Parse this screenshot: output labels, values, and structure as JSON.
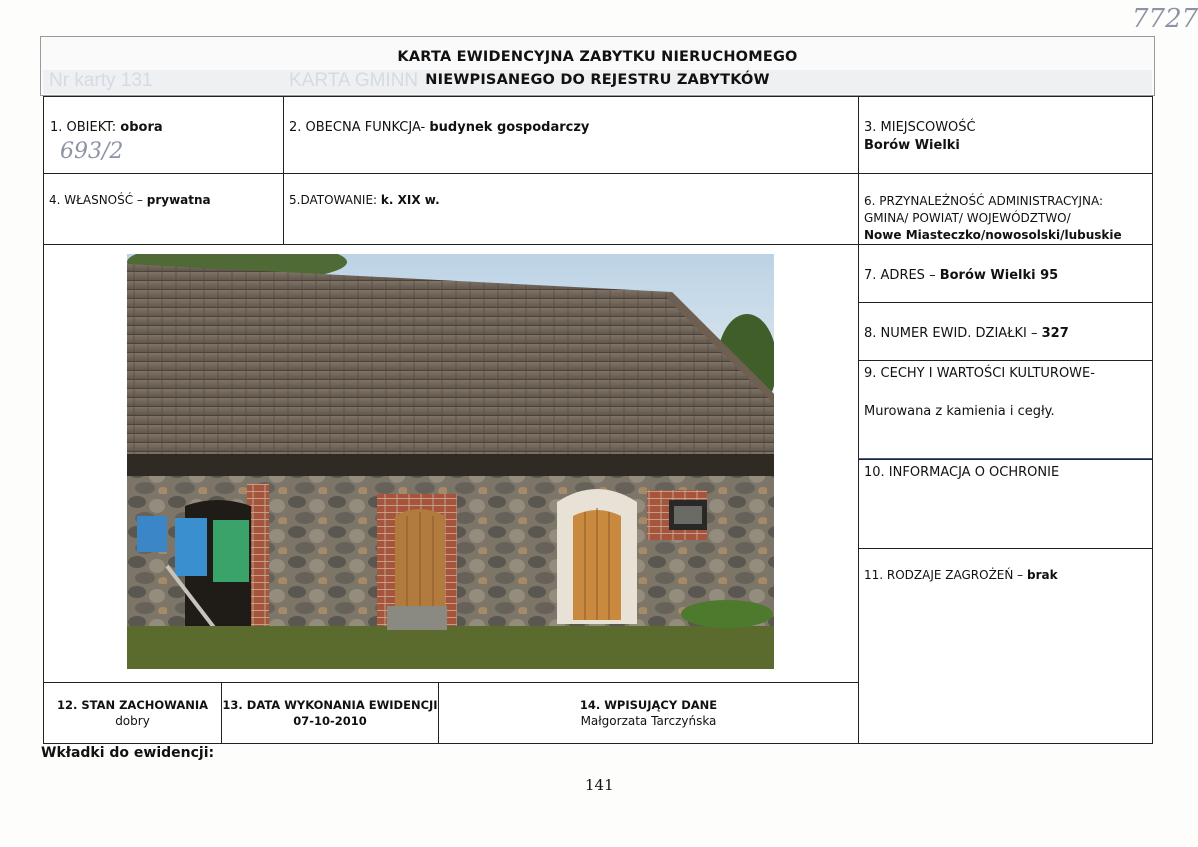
{
  "handwritten_number": "7727",
  "header": {
    "title_line1": "KARTA EWIDENCYJNA ZABYTKU NIERUCHOMEGO",
    "title_line2": "NIEWPISANEGO DO REJESTRU ZABYTKÓW",
    "ghost_left": "Nr karty 131",
    "ghost_right": "KARTA GMINN"
  },
  "field1": {
    "label": "1. OBIEKT: ",
    "value": "obora",
    "handwritten": "693/2"
  },
  "field2": {
    "label": "2. OBECNA FUNKCJA- ",
    "value": "budynek gospodarczy"
  },
  "field3": {
    "label": "3. MIEJSCOWOŚĆ",
    "value": "Borów Wielki"
  },
  "field4": {
    "label": "4. WŁASNOŚĆ – ",
    "value": "prywatna"
  },
  "field5": {
    "label": "5.DATOWANIE: ",
    "value": "k. XIX w."
  },
  "field6": {
    "line1": "6. PRZYNALEŻNOŚĆ ADMINISTRACYJNA:",
    "line2": "GMINA/ POWIAT/ WOJEWÓDZTWO/",
    "value": "Nowe Miasteczko/nowosolski/lubuskie"
  },
  "field7": {
    "label": "7. ADRES – ",
    "value": "Borów Wielki 95"
  },
  "field8": {
    "label": "8. NUMER EWID. DZIAŁKI – ",
    "value": "327"
  },
  "field9": {
    "label": "9. CECHY  I WARTOŚCI KULTUROWE-",
    "value": "Murowana z kamienia i cegły."
  },
  "field10": {
    "label": "10. INFORMACJA O OCHRONIE"
  },
  "field11": {
    "label": "11. RODZAJE ZAGROŻEŃ – ",
    "value": "brak"
  },
  "field12": {
    "label": "12. STAN ZACHOWANIA",
    "value": "dobry"
  },
  "field13": {
    "label": "13. DATA WYKONANIA EWIDENCJI",
    "value": "07-10-2010"
  },
  "field14": {
    "label": "14. WPISUJĄCY DANE",
    "value": "Małgorzata Tarczyńska"
  },
  "footer_note": "Wkładki do ewidencji:",
  "page_number": "141"
}
